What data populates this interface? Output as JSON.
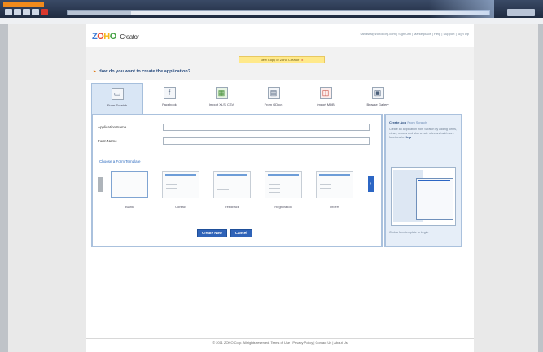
{
  "app": {
    "logo_text": "ZOHO",
    "logo_sub": "Creator",
    "top_links": "sahasra@zohocorp.com | Sign Out | Marketplace | Help | Support | Sign Up"
  },
  "notice": {
    "text": "New Copy of Zoho Creator",
    "close": "x"
  },
  "question": "How do you want to create the application?",
  "tabs": [
    {
      "label": "From Scratch",
      "icon": "blank-page-icon"
    },
    {
      "label": "Facebook",
      "icon": "facebook-icon"
    },
    {
      "label": "Import XLS, CSV",
      "icon": "spreadsheet-icon"
    },
    {
      "label": "From GDocs",
      "icon": "google-docs-icon"
    },
    {
      "label": "Import MDB",
      "icon": "database-icon"
    },
    {
      "label": "Browse Gallery",
      "icon": "gallery-icon"
    }
  ],
  "form": {
    "app_name_label": "Application Name",
    "form_name_label": "Form Name",
    "app_name_value": "",
    "form_name_value": "",
    "choose_template": "Choose a Form Template",
    "templates": [
      "Blank",
      "Contact",
      "Feedback",
      "Registration",
      "Orders"
    ],
    "create_button": "Create Now",
    "cancel_button": "Cancel"
  },
  "help": {
    "title": "Create App",
    "title_suffix": "From Scratch",
    "body": "Create an application from Scratch by adding forms, views, reports and also create rules and add more functions to",
    "body_link": "Help",
    "footer": "Click a form template to begin."
  },
  "footer": "© 2011 ZOHO Corp. All rights reserved. Terms of Use | Privacy Policy | Contact Us | About Us"
}
